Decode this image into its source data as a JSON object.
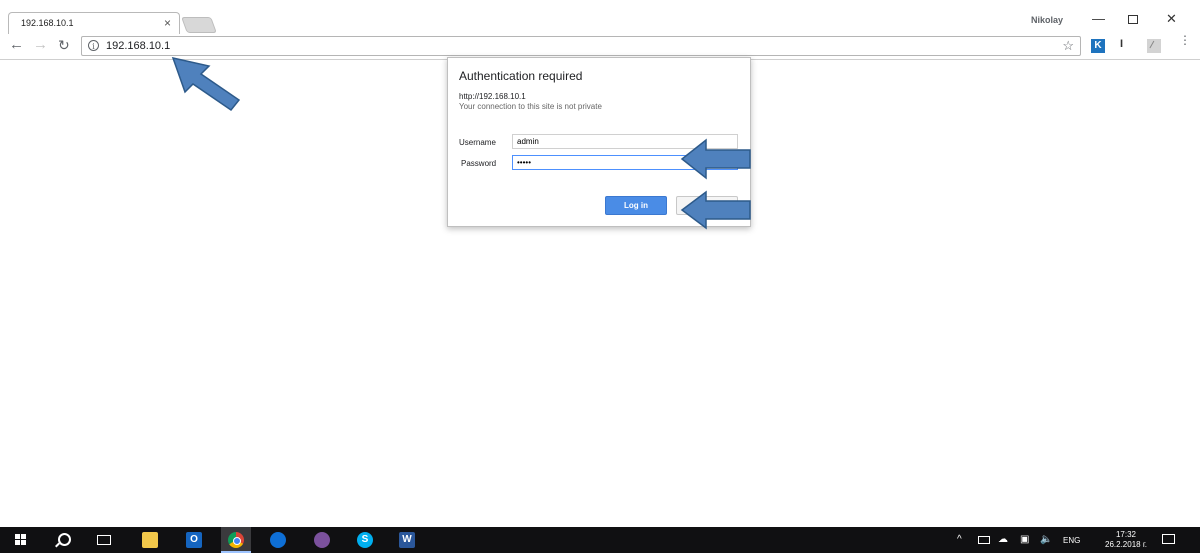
{
  "browser": {
    "tab": {
      "title": "192.168.10.1",
      "close_glyph": "×"
    },
    "profile_name": "Nikolay",
    "window_controls": {
      "minimize": "—",
      "close": "✕"
    },
    "toolbar": {
      "back_glyph": "←",
      "forward_glyph": "→",
      "reload_glyph": "↻",
      "url": "192.168.10.1",
      "info_glyph": "i",
      "star_glyph": "☆",
      "extension_k": "K",
      "extension_i": "I",
      "menu_glyph": "⋮"
    }
  },
  "dialog": {
    "title": "Authentication required",
    "url": "http://192.168.10.1",
    "note": "Your connection to this site is not private",
    "username_label": "Username",
    "username_value": "admin",
    "password_label": "Password",
    "password_value": "•••••",
    "login_label": "Log in",
    "cancel_label": ""
  },
  "annotation_color": "#4f81bd",
  "taskbar": {
    "apps": [
      "windows-start",
      "search",
      "task-view",
      "file-explorer",
      "outlook",
      "chrome",
      "teamviewer",
      "viber",
      "skype",
      "word"
    ],
    "outlook_letter": "O",
    "skype_letter": "S",
    "word_letter": "W",
    "tray_up_glyph": "^",
    "tray_volume_glyph": "🔈",
    "language": "ENG",
    "time": "17:32",
    "date": "26.2.2018 г."
  }
}
